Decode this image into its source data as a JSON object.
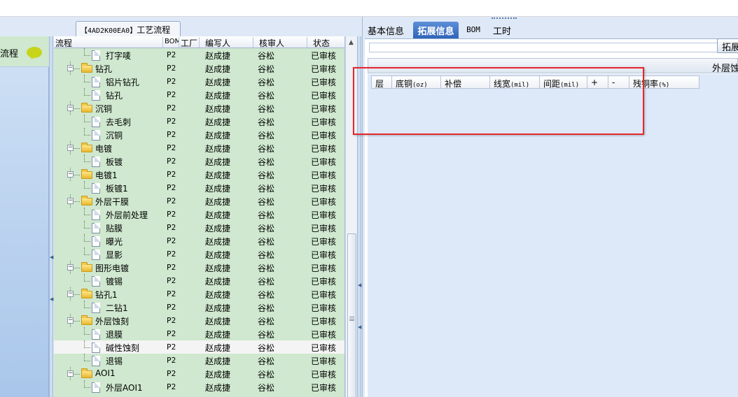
{
  "colors": {
    "tree_background": "#cfe8cf",
    "active_tab": "#2f63b8",
    "annotation_box": "#e8242a",
    "pane_background": "#dfe8f6",
    "grid_background": "#dde9f8"
  },
  "left_nav": {
    "item_label": "流程",
    "icon": "speech-bubble-icon"
  },
  "process_panel": {
    "title_code": "【4AD2K00EA0】",
    "title_text": "工艺流程",
    "columns": [
      "流程",
      "BOM",
      "工厂",
      "编写人",
      "核审人",
      "状态"
    ],
    "rows": [
      {
        "name": "打字唛",
        "level": 1,
        "type": "doc",
        "factory": "P2",
        "author": "赵成捷",
        "reviewer": "谷松",
        "status": "已审核"
      },
      {
        "name": "钻孔",
        "level": 0,
        "type": "folder",
        "factory": "P2",
        "author": "赵成捷",
        "reviewer": "谷松",
        "status": "已审核"
      },
      {
        "name": "铝片钻孔",
        "level": 1,
        "type": "doc",
        "factory": "P2",
        "author": "赵成捷",
        "reviewer": "谷松",
        "status": "已审核"
      },
      {
        "name": "钻孔",
        "level": 1,
        "type": "doc",
        "factory": "P2",
        "author": "赵成捷",
        "reviewer": "谷松",
        "status": "已审核"
      },
      {
        "name": "沉铜",
        "level": 0,
        "type": "folder",
        "factory": "P2",
        "author": "赵成捷",
        "reviewer": "谷松",
        "status": "已审核"
      },
      {
        "name": "去毛刺",
        "level": 1,
        "type": "doc",
        "factory": "P2",
        "author": "赵成捷",
        "reviewer": "谷松",
        "status": "已审核"
      },
      {
        "name": "沉铜",
        "level": 1,
        "type": "doc",
        "factory": "P2",
        "author": "赵成捷",
        "reviewer": "谷松",
        "status": "已审核"
      },
      {
        "name": "电镀",
        "level": 0,
        "type": "folder",
        "factory": "P2",
        "author": "赵成捷",
        "reviewer": "谷松",
        "status": "已审核"
      },
      {
        "name": "板镀",
        "level": 1,
        "type": "doc",
        "factory": "P2",
        "author": "赵成捷",
        "reviewer": "谷松",
        "status": "已审核"
      },
      {
        "name": "电镀1",
        "level": 0,
        "type": "folder",
        "factory": "P2",
        "author": "赵成捷",
        "reviewer": "谷松",
        "status": "已审核"
      },
      {
        "name": "板镀1",
        "level": 1,
        "type": "doc",
        "factory": "P2",
        "author": "赵成捷",
        "reviewer": "谷松",
        "status": "已审核"
      },
      {
        "name": "外层干膜",
        "level": 0,
        "type": "folder",
        "factory": "P2",
        "author": "赵成捷",
        "reviewer": "谷松",
        "status": "已审核"
      },
      {
        "name": "外层前处理",
        "level": 1,
        "type": "doc",
        "factory": "P2",
        "author": "赵成捷",
        "reviewer": "谷松",
        "status": "已审核"
      },
      {
        "name": "贴膜",
        "level": 1,
        "type": "doc",
        "factory": "P2",
        "author": "赵成捷",
        "reviewer": "谷松",
        "status": "已审核"
      },
      {
        "name": "曝光",
        "level": 1,
        "type": "doc",
        "factory": "P2",
        "author": "赵成捷",
        "reviewer": "谷松",
        "status": "已审核"
      },
      {
        "name": "显影",
        "level": 1,
        "type": "doc",
        "factory": "P2",
        "author": "赵成捷",
        "reviewer": "谷松",
        "status": "已审核"
      },
      {
        "name": "图形电镀",
        "level": 0,
        "type": "folder",
        "factory": "P2",
        "author": "赵成捷",
        "reviewer": "谷松",
        "status": "已审核"
      },
      {
        "name": "镀锡",
        "level": 1,
        "type": "doc",
        "factory": "P2",
        "author": "赵成捷",
        "reviewer": "谷松",
        "status": "已审核"
      },
      {
        "name": "钻孔1",
        "level": 0,
        "type": "folder",
        "factory": "P2",
        "author": "赵成捷",
        "reviewer": "谷松",
        "status": "已审核"
      },
      {
        "name": "二钻1",
        "level": 1,
        "type": "doc",
        "factory": "P2",
        "author": "赵成捷",
        "reviewer": "谷松",
        "status": "已审核"
      },
      {
        "name": "外层蚀刻",
        "level": 0,
        "type": "folder",
        "factory": "P2",
        "author": "赵成捷",
        "reviewer": "谷松",
        "status": "已审核"
      },
      {
        "name": "退膜",
        "level": 1,
        "type": "doc",
        "factory": "P2",
        "author": "赵成捷",
        "reviewer": "谷松",
        "status": "已审核"
      },
      {
        "name": "碱性蚀刻",
        "level": 1,
        "type": "doc",
        "factory": "P2",
        "author": "赵成捷",
        "reviewer": "谷松",
        "status": "已审核",
        "selected": true
      },
      {
        "name": "退锡",
        "level": 1,
        "type": "doc",
        "factory": "P2",
        "author": "赵成捷",
        "reviewer": "谷松",
        "status": "已审核"
      },
      {
        "name": "AOI1",
        "level": 0,
        "type": "folder",
        "factory": "P2",
        "author": "赵成捷",
        "reviewer": "谷松",
        "status": "已审核"
      },
      {
        "name": "外层AOI1",
        "level": 1,
        "type": "doc",
        "factory": "P2",
        "author": "赵成捷",
        "reviewer": "谷松",
        "status": "已审核"
      }
    ]
  },
  "detail_panel": {
    "tabs": [
      {
        "label": "基本信息",
        "active": false
      },
      {
        "label": "拓展信息",
        "active": true
      },
      {
        "label": "BOM",
        "active": false
      },
      {
        "label": "工时",
        "active": false
      }
    ],
    "expand_button_label": "拓展",
    "group_label": "外层蚀",
    "grid_columns": [
      {
        "label": "层",
        "unit": ""
      },
      {
        "label": "底铜",
        "unit": "(oz)"
      },
      {
        "label": "补偿",
        "unit": ""
      },
      {
        "label": "线宽",
        "unit": "(mil)"
      },
      {
        "label": "间距",
        "unit": "(mil)"
      },
      {
        "label": "+",
        "unit": ""
      },
      {
        "label": "-",
        "unit": ""
      },
      {
        "label": "残铜率",
        "unit": "(%)"
      }
    ]
  }
}
